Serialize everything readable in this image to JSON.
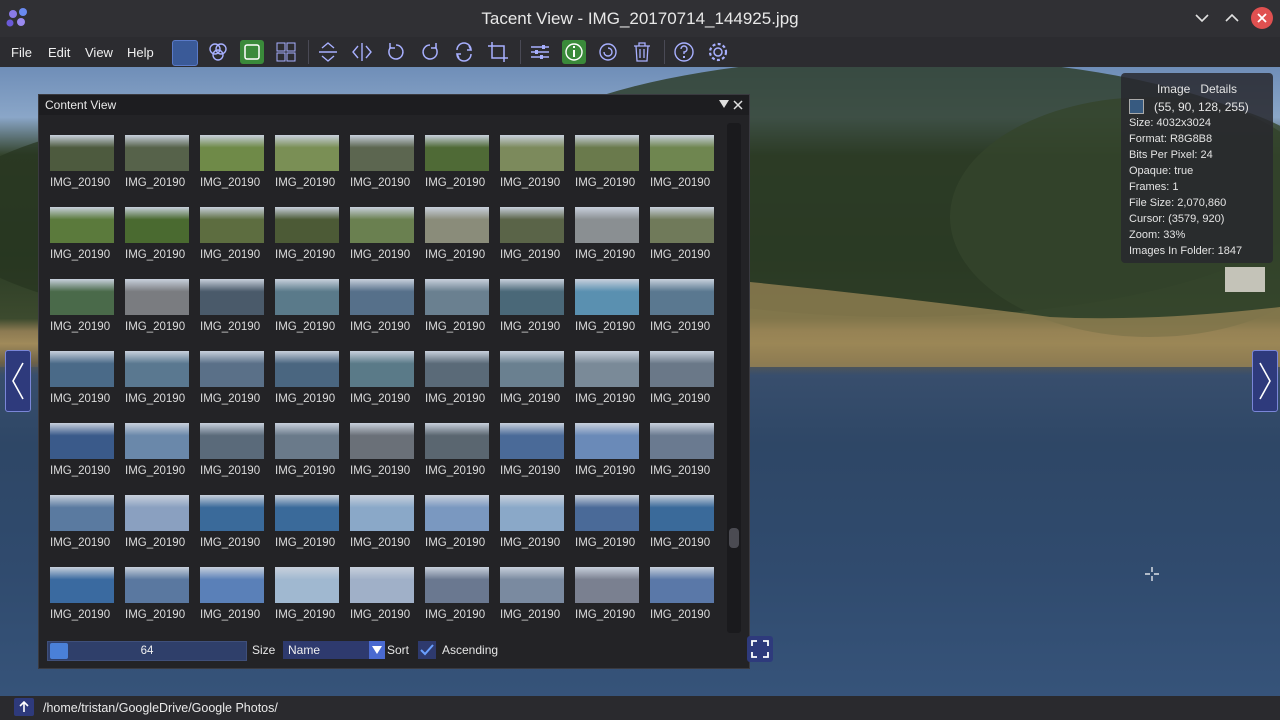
{
  "window": {
    "title": "Tacent View - IMG_20170714_144925.jpg"
  },
  "menu": [
    "File",
    "Edit",
    "View",
    "Help"
  ],
  "toolbar": {
    "icons": [
      "background-color-icon",
      "channels-icon",
      "tile-icon",
      "grid-icon",
      "flip-vertical-icon",
      "flip-horizontal-icon",
      "rotate-ccw-icon",
      "rotate-cw-icon",
      "refresh-icon",
      "crop-icon",
      "adjust-icon",
      "info-icon",
      "reload-icon",
      "delete-icon",
      "help-icon",
      "settings-icon"
    ]
  },
  "info_panel": {
    "header": "Image   Details",
    "swatch_color": "#375A80",
    "rgba": "(55, 90, 128, 255)",
    "size": "Size: 4032x3024",
    "format": "Format: R8G8B8",
    "bpp": "Bits Per Pixel: 24",
    "opaque": "Opaque: true",
    "frames": "Frames: 1",
    "file_size": "File Size: 2,070,860",
    "cursor": "Cursor: (3579, 920)",
    "zoom": "Zoom: 33%",
    "images_in_folder": "Images In Folder: 1847"
  },
  "content_view": {
    "title": "Content View",
    "thumb_label": "IMG_20190",
    "rows": 7,
    "cols": 9,
    "thumb_colors": [
      [
        "#4d5a3e",
        "#56624a",
        "#6f8a48",
        "#7a8f55",
        "#5c6650",
        "#4f6a36",
        "#7c8a5c",
        "#6a7a4c",
        "#6f8650"
      ],
      [
        "#5b7a3c",
        "#4a6a30",
        "#5d6d40",
        "#4c5a36",
        "#6a8050",
        "#8a8c7a",
        "#5a6448",
        "#8a8f92",
        "#707a5a"
      ],
      [
        "#4a6a4a",
        "#7a7c80",
        "#4a5a6a",
        "#5a7a8a",
        "#56708a",
        "#6a8090",
        "#4a6878",
        "#5a90b0",
        "#5a7890"
      ],
      [
        "#4a6a88",
        "#5a7890",
        "#5a7088",
        "#4a6680",
        "#5a7a88",
        "#5a6a78",
        "#6a8090",
        "#7a8a98",
        "#6a7888"
      ],
      [
        "#3a5a8a",
        "#6a88aa",
        "#5a6a7a",
        "#6a7a8a",
        "#6a7078",
        "#5a6670",
        "#4a6a98",
        "#6a8ab8",
        "#6a7a90"
      ],
      [
        "#5a7aa0",
        "#8aa0c0",
        "#3a6a9a",
        "#3a6a9a",
        "#8aa8c8",
        "#7a98c0",
        "#8aa8c8",
        "#4a6a98",
        "#3a6a9a"
      ],
      [
        "#3a6aa0",
        "#5a78a0",
        "#5a80b8",
        "#a0b8d0",
        "#a0b0c8",
        "#6a7890",
        "#7a8aa0",
        "#7a8090",
        "#5a78a8"
      ]
    ],
    "size_value": "64",
    "size_label": "Size",
    "sort_value": "Name",
    "sort_label": "Sort",
    "ascending_label": "Ascending",
    "ascending_checked": true
  },
  "status_bar": {
    "path": "/home/tristan/GoogleDrive/Google Photos/"
  }
}
